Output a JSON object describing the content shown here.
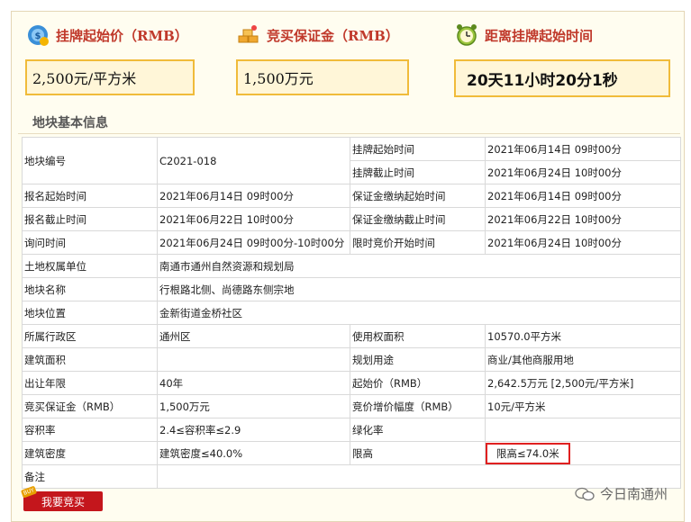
{
  "header": {
    "start_price": {
      "label": "挂牌起始价（RMB）",
      "value": "2,500元/平方米"
    },
    "deposit": {
      "label": "竞买保证金（RMB）",
      "value": "1,500万元"
    },
    "countdown": {
      "label": "距离挂牌起始时间",
      "value": "20天11小时20分1秒"
    }
  },
  "section_title": "地块基本信息",
  "table": {
    "row1": {
      "k1": "地块编号",
      "v1": "C2021-018",
      "k2a": "挂牌起始时间",
      "v2a": "2021年06月14日 09时00分",
      "k2b": "挂牌截止时间",
      "v2b": "2021年06月24日 10时00分"
    },
    "rows": [
      [
        "报名起始时间",
        "2021年06月14日 09时00分",
        "保证金缴纳起始时间",
        "2021年06月14日 09时00分"
      ],
      [
        "报名截止时间",
        "2021年06月22日 10时00分",
        "保证金缴纳截止时间",
        "2021年06月22日 10时00分"
      ],
      [
        "询问时间",
        "2021年06月24日 09时00分-10时00分",
        "限时竞价开始时间",
        "2021年06月24日 10时00分"
      ]
    ],
    "wide_rows": [
      [
        "土地权属单位",
        "南通市通州自然资源和规划局"
      ],
      [
        "地块名称",
        "行根路北侧、尚德路东侧宗地"
      ],
      [
        "地块位置",
        "金新街道金桥社区"
      ]
    ],
    "rows2": [
      [
        "所属行政区",
        "通州区",
        "使用权面积",
        "10570.0平方米"
      ],
      [
        "建筑面积",
        "",
        "规划用途",
        "商业/其他商服用地"
      ],
      [
        "出让年限",
        "40年",
        "起始价（RMB）",
        "2,642.5万元 [2,500元/平方米]"
      ],
      [
        "竞买保证金（RMB）",
        "1,500万元",
        "竞价增价幅度（RMB）",
        "10元/平方米"
      ],
      [
        "容积率",
        "2.4≤容积率≤2.9",
        "绿化率",
        ""
      ],
      [
        "建筑密度",
        "建筑密度≤40.0%",
        "限高",
        "限高≤74.0米"
      ]
    ],
    "remark_label": "备注",
    "remark_value": ""
  },
  "bid_button": {
    "badge": "BUY",
    "label": "我要竞买"
  },
  "watermark": {
    "text": "今日南通州"
  },
  "colors": {
    "accent_red": "#c0392b",
    "box_border": "#f0bb3a",
    "box_bg": "#fff6d8",
    "button_red": "#c4161c",
    "highlight": "#e02020"
  }
}
